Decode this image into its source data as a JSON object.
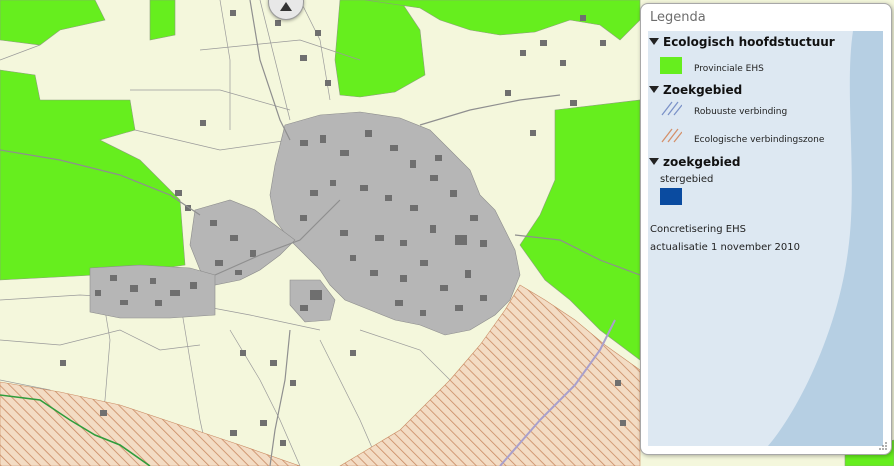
{
  "legend": {
    "title": "Legenda",
    "sections": [
      {
        "heading": "Ecologisch hoofdstuctuur",
        "items": [
          {
            "label": "Provinciale EHS",
            "swatch": "solid",
            "color": "#66ee1e"
          }
        ]
      },
      {
        "heading": "Zoekgebied",
        "items": [
          {
            "label": "Robuuste verbinding",
            "swatch": "hatch",
            "color": "#7b92c8"
          },
          {
            "label": "Ecologische verbindingszone",
            "swatch": "hatch",
            "color": "#d4906a"
          }
        ]
      },
      {
        "heading": "zoekgebied",
        "items": [
          {
            "label": "stergebied",
            "swatch": "solid",
            "color": "#0a4ba0"
          }
        ]
      }
    ],
    "notes": [
      "Concretisering EHS",
      "actualisatie 1 november 2010"
    ]
  },
  "map": {
    "colors": {
      "ehs_green": "#66ee1e",
      "built_gray": "#b6b6b6",
      "building_dark": "#6f6f6f",
      "rural_pale": "#f4f7dc",
      "hatch_orange": "#d4906a",
      "stream_green": "#2f9d3c",
      "road_purple": "#a9a0cc"
    },
    "icons": {
      "pan": "pan-arrow-icon",
      "grip": "resize-grip-icon"
    }
  }
}
